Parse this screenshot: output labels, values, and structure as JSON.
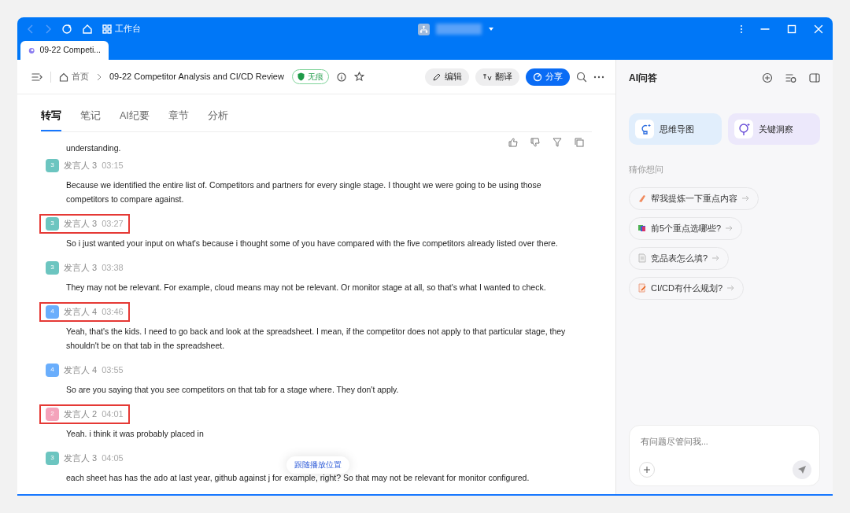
{
  "window": {
    "nav_label": "工作台",
    "tabs": [
      {
        "label": "09-22 Competi...",
        "selected": true
      }
    ]
  },
  "toolbar": {
    "home": "首页",
    "title": "09-22 Competitor Analysis and CI/CD Review",
    "badge": "无痕",
    "buttons": [
      {
        "label": "编辑",
        "kind": "edit",
        "primary": false
      },
      {
        "label": "翻译",
        "kind": "translate",
        "primary": false
      },
      {
        "label": "分享",
        "kind": "share",
        "primary": true
      }
    ]
  },
  "tabs": [
    {
      "label": "转写",
      "selected": true
    },
    {
      "label": "笔记",
      "selected": false
    },
    {
      "label": "AI纪要",
      "selected": false
    },
    {
      "label": "章节",
      "selected": false
    },
    {
      "label": "分析",
      "selected": false
    }
  ],
  "transcript": {
    "clipped_text": "understanding.",
    "entries": [
      {
        "avatar": "3",
        "speaker": "发言人 3",
        "time": "03:15",
        "color": "#6cc5c0",
        "highlighted": false,
        "text": "Because we identified the entire list of. Competitors and partners for every single stage. I thought we were going to be using those competitors to compare against."
      },
      {
        "avatar": "3",
        "speaker": "发言人 3",
        "time": "03:27",
        "color": "#6cc5c0",
        "highlighted": true,
        "text": "So i just wanted your input on what's because i thought some of you have compared with the five competitors already listed over there."
      },
      {
        "avatar": "3",
        "speaker": "发言人 3",
        "time": "03:38",
        "color": "#6cc5c0",
        "highlighted": false,
        "text": "They may not be relevant. For example, cloud means may not be relevant. Or monitor stage at all, so that's what I wanted to check."
      },
      {
        "avatar": "4",
        "speaker": "发言人 4",
        "time": "03:46",
        "color": "#6aaefc",
        "highlighted": true,
        "text": "Yeah, that's the kids. I need to go back and look at the spreadsheet. I mean, if the competitor does not apply to that particular stage, they shouldn't be on that tab in the spreadsheet."
      },
      {
        "avatar": "4",
        "speaker": "发言人 4",
        "time": "03:55",
        "color": "#6aaefc",
        "highlighted": false,
        "text": "So are you saying that you see competitors on that tab for a stage where. They don't apply."
      },
      {
        "avatar": "2",
        "speaker": "发言人 2",
        "time": "04:01",
        "color": "#f4a3bb",
        "highlighted": true,
        "text": "Yeah.  i think it was probably placed in"
      },
      {
        "avatar": "3",
        "speaker": "发言人 3",
        "time": "04:05",
        "color": "#6cc5c0",
        "highlighted": false,
        "text": "each sheet has has the ado at last year, github against j for example, right? So that may not be relevant for monitor configured."
      }
    ],
    "follow_button": "跟随播放位置"
  },
  "ai_panel": {
    "title": "AI问答",
    "tools": [
      {
        "label": "思维导图",
        "kind": "mindmap"
      },
      {
        "label": "关键洞察",
        "kind": "insight"
      }
    ],
    "suggest_title": "猜你想问",
    "suggestions": [
      {
        "text": "帮我提炼一下重点内容",
        "kind": "pen"
      },
      {
        "text": "前5个重点选哪些?",
        "kind": "cards"
      },
      {
        "text": "竞品表怎么填?",
        "kind": "doc"
      },
      {
        "text": "CI/CD有什么规划?",
        "kind": "edit"
      }
    ],
    "input": {
      "placeholder": "有问题尽管问我..."
    }
  }
}
